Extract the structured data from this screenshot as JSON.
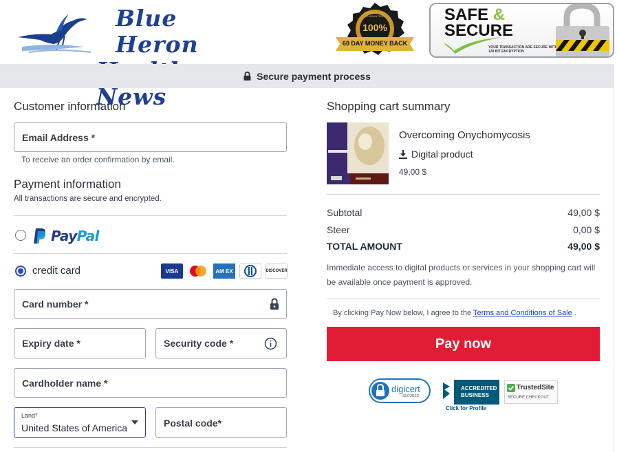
{
  "header": {
    "logo_line1": "Blue Heron",
    "logo_line2": "Health News",
    "guarantee_top": "SATISFACTION GUARANTEED",
    "guarantee_pct": "100%",
    "guarantee_bottom": "60 DAY MONEY BACK",
    "safe_title_1": "SAFE",
    "safe_amp": "&",
    "safe_title_2": "SECURE",
    "safe_small": "YOUR TRANSACTION ARE SECURE WITH SSL 128 BIT ENCRYPTION"
  },
  "secure_bar": {
    "text": "Secure payment process"
  },
  "customer": {
    "title": "Customer information",
    "email_label": "Email Address *",
    "email_helper": "To receive an order confirmation by email."
  },
  "payment": {
    "title": "Payment information",
    "subtitle": "All transactions are secure and encrypted.",
    "paypal_pay": "Pay",
    "paypal_pal": "Pal",
    "credit_card_label": "credit card",
    "card_brands": [
      "VISA",
      "MC",
      "AMEX",
      "DINERS",
      "DISCOVER"
    ],
    "card_number_label": "Card number *",
    "expiry_label": "Expiry date *",
    "security_label": "Security code *",
    "cardholder_label": "Cardholder name *",
    "country_small": "Land*",
    "country_value": "United States of America",
    "postal_label": "Postal code*"
  },
  "cart": {
    "title": "Shopping cart summary",
    "product_title": "Overcoming Onychomycosis",
    "product_type": "Digital product",
    "product_price": "49,00 $",
    "rows": [
      {
        "label": "Subtotal",
        "amount": "49,00 $"
      },
      {
        "label": "Steer",
        "amount": "0,00 $"
      },
      {
        "label": "TOTAL AMOUNT",
        "amount": "49,00 $"
      }
    ],
    "notice": "Immediate access to digital products or services in your shopping cart will be available once payment is approved.",
    "terms_prefix": "By clicking Pay Now below, I agree to the",
    "terms_link": "Terms and Conditions of Sale",
    "terms_suffix": ".",
    "pay_button": "Pay now"
  },
  "trust": {
    "digicert": "digicert",
    "digicert_sub": "SECURED",
    "bbb_line1": "ACCREDITED",
    "bbb_line2": "BUSINESS",
    "bbb_link": "Click for Profile",
    "trustedsite": "TrustedSite",
    "trustedsite_sub": "SECURE CHECKOUT"
  },
  "colors": {
    "accent": "#2948c7",
    "pay_button": "#e11d35",
    "logo_blue": "#1f3f93"
  }
}
